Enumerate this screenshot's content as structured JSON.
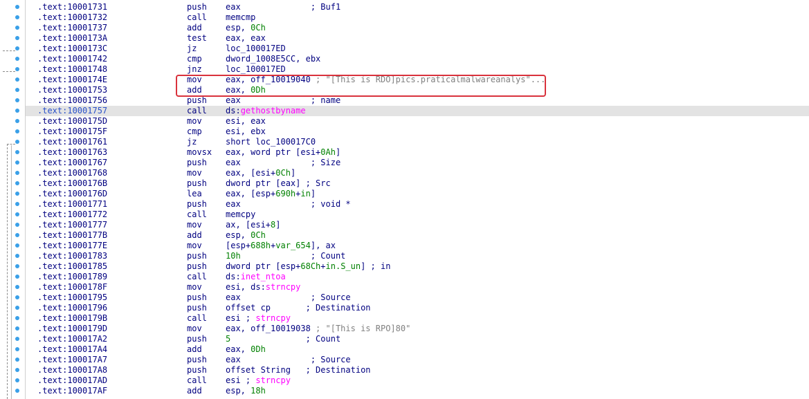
{
  "listing": {
    "rows": [
      {
        "addr": ".text:10001731",
        "mn": "push",
        "ops": [
          {
            "t": "eax",
            "c": ""
          },
          {
            "t": "              ; Buf1",
            "c": "cmt"
          }
        ]
      },
      {
        "addr": ".text:10001732",
        "mn": "call",
        "ops": [
          {
            "t": "memcmp",
            "c": ""
          }
        ]
      },
      {
        "addr": ".text:10001737",
        "mn": "add",
        "ops": [
          {
            "t": "esp, ",
            "c": ""
          },
          {
            "t": "0Ch",
            "c": "num"
          }
        ]
      },
      {
        "addr": ".text:1000173A",
        "mn": "test",
        "ops": [
          {
            "t": "eax, eax",
            "c": ""
          }
        ]
      },
      {
        "addr": ".text:1000173C",
        "mn": "jz",
        "ops": [
          {
            "t": "loc_100017ED",
            "c": ""
          }
        ]
      },
      {
        "addr": ".text:10001742",
        "mn": "cmp",
        "ops": [
          {
            "t": "dword_1008E5CC, ebx",
            "c": ""
          }
        ]
      },
      {
        "addr": ".text:10001748",
        "mn": "jnz",
        "ops": [
          {
            "t": "loc_100017ED",
            "c": ""
          }
        ]
      },
      {
        "addr": ".text:1000174E",
        "mn": "mov",
        "ops": [
          {
            "t": "eax, off_10019040 ",
            "c": ""
          },
          {
            "t": "; \"[This is RDO]pics.praticalmalwareanalys\"...",
            "c": "str"
          }
        ]
      },
      {
        "addr": ".text:10001753",
        "mn": "add",
        "ops": [
          {
            "t": "eax, ",
            "c": ""
          },
          {
            "t": "0Dh",
            "c": "num"
          }
        ]
      },
      {
        "addr": ".text:10001756",
        "mn": "push",
        "ops": [
          {
            "t": "eax",
            "c": ""
          },
          {
            "t": "              ; name",
            "c": "cmt"
          }
        ]
      },
      {
        "addr": ".text:10001757",
        "mn": "call",
        "ops": [
          {
            "t": "ds:",
            "c": ""
          },
          {
            "t": "gethostbyname",
            "c": "imp"
          }
        ],
        "hl": true
      },
      {
        "addr": ".text:1000175D",
        "mn": "mov",
        "ops": [
          {
            "t": "esi, eax",
            "c": ""
          }
        ]
      },
      {
        "addr": ".text:1000175F",
        "mn": "cmp",
        "ops": [
          {
            "t": "esi, ebx",
            "c": ""
          }
        ]
      },
      {
        "addr": ".text:10001761",
        "mn": "jz",
        "ops": [
          {
            "t": "short loc_100017C0",
            "c": ""
          }
        ]
      },
      {
        "addr": ".text:10001763",
        "mn": "movsx",
        "ops": [
          {
            "t": "eax, word ptr [esi+",
            "c": ""
          },
          {
            "t": "0Ah",
            "c": "num"
          },
          {
            "t": "]",
            "c": ""
          }
        ]
      },
      {
        "addr": ".text:10001767",
        "mn": "push",
        "ops": [
          {
            "t": "eax",
            "c": ""
          },
          {
            "t": "              ; Size",
            "c": "cmt"
          }
        ]
      },
      {
        "addr": ".text:10001768",
        "mn": "mov",
        "ops": [
          {
            "t": "eax, [esi+",
            "c": ""
          },
          {
            "t": "0Ch",
            "c": "num"
          },
          {
            "t": "]",
            "c": ""
          }
        ]
      },
      {
        "addr": ".text:1000176B",
        "mn": "push",
        "ops": [
          {
            "t": "dword ptr [eax] ; Src",
            "c": ""
          }
        ]
      },
      {
        "addr": ".text:1000176D",
        "mn": "lea",
        "ops": [
          {
            "t": "eax, [esp+",
            "c": ""
          },
          {
            "t": "690h",
            "c": "num"
          },
          {
            "t": "+",
            "c": ""
          },
          {
            "t": "in",
            "c": "num"
          },
          {
            "t": "]",
            "c": ""
          }
        ]
      },
      {
        "addr": ".text:10001771",
        "mn": "push",
        "ops": [
          {
            "t": "eax",
            "c": ""
          },
          {
            "t": "              ; void *",
            "c": "cmt"
          }
        ]
      },
      {
        "addr": ".text:10001772",
        "mn": "call",
        "ops": [
          {
            "t": "memcpy",
            "c": ""
          }
        ]
      },
      {
        "addr": ".text:10001777",
        "mn": "mov",
        "ops": [
          {
            "t": "ax, [esi+",
            "c": ""
          },
          {
            "t": "8",
            "c": "num"
          },
          {
            "t": "]",
            "c": ""
          }
        ]
      },
      {
        "addr": ".text:1000177B",
        "mn": "add",
        "ops": [
          {
            "t": "esp, ",
            "c": ""
          },
          {
            "t": "0Ch",
            "c": "num"
          }
        ]
      },
      {
        "addr": ".text:1000177E",
        "mn": "mov",
        "ops": [
          {
            "t": "[esp+",
            "c": ""
          },
          {
            "t": "688h",
            "c": "num"
          },
          {
            "t": "+",
            "c": ""
          },
          {
            "t": "var_654",
            "c": "num"
          },
          {
            "t": "], ax",
            "c": ""
          }
        ]
      },
      {
        "addr": ".text:10001783",
        "mn": "push",
        "ops": [
          {
            "t": "10h",
            "c": "num"
          },
          {
            "t": "              ; Count",
            "c": "cmt"
          }
        ]
      },
      {
        "addr": ".text:10001785",
        "mn": "push",
        "ops": [
          {
            "t": "dword ptr [esp+",
            "c": ""
          },
          {
            "t": "68Ch",
            "c": "num"
          },
          {
            "t": "+",
            "c": ""
          },
          {
            "t": "in.S_un",
            "c": "num"
          },
          {
            "t": "] ; in",
            "c": ""
          }
        ]
      },
      {
        "addr": ".text:10001789",
        "mn": "call",
        "ops": [
          {
            "t": "ds:",
            "c": ""
          },
          {
            "t": "inet_ntoa",
            "c": "imp"
          }
        ]
      },
      {
        "addr": ".text:1000178F",
        "mn": "mov",
        "ops": [
          {
            "t": "esi, ds:",
            "c": ""
          },
          {
            "t": "strncpy",
            "c": "imp"
          }
        ]
      },
      {
        "addr": ".text:10001795",
        "mn": "push",
        "ops": [
          {
            "t": "eax",
            "c": ""
          },
          {
            "t": "              ; Source",
            "c": "cmt"
          }
        ]
      },
      {
        "addr": ".text:10001796",
        "mn": "push",
        "ops": [
          {
            "t": "offset cp",
            "c": ""
          },
          {
            "t": "       ; Destination",
            "c": "cmt"
          }
        ]
      },
      {
        "addr": ".text:1000179B",
        "mn": "call",
        "ops": [
          {
            "t": "esi ; ",
            "c": ""
          },
          {
            "t": "strncpy",
            "c": "imp"
          }
        ]
      },
      {
        "addr": ".text:1000179D",
        "mn": "mov",
        "ops": [
          {
            "t": "eax, off_10019038 ",
            "c": ""
          },
          {
            "t": "; \"[This is RPO]80\"",
            "c": "str"
          }
        ]
      },
      {
        "addr": ".text:100017A2",
        "mn": "push",
        "ops": [
          {
            "t": "5",
            "c": "num"
          },
          {
            "t": "               ; Count",
            "c": "cmt"
          }
        ]
      },
      {
        "addr": ".text:100017A4",
        "mn": "add",
        "ops": [
          {
            "t": "eax, ",
            "c": ""
          },
          {
            "t": "0Dh",
            "c": "num"
          }
        ]
      },
      {
        "addr": ".text:100017A7",
        "mn": "push",
        "ops": [
          {
            "t": "eax",
            "c": ""
          },
          {
            "t": "              ; Source",
            "c": "cmt"
          }
        ]
      },
      {
        "addr": ".text:100017A8",
        "mn": "push",
        "ops": [
          {
            "t": "offset String",
            "c": ""
          },
          {
            "t": "   ; Destination",
            "c": "cmt"
          }
        ]
      },
      {
        "addr": ".text:100017AD",
        "mn": "call",
        "ops": [
          {
            "t": "esi ; ",
            "c": ""
          },
          {
            "t": "strncpy",
            "c": "imp"
          }
        ]
      },
      {
        "addr": ".text:100017AF",
        "mn": "add",
        "ops": [
          {
            "t": "esp, ",
            "c": ""
          },
          {
            "t": "18h",
            "c": "num"
          }
        ]
      }
    ]
  },
  "colors": {
    "operand": "#000080",
    "number": "#008000",
    "import": "#ff00ff",
    "string_comment": "#808080",
    "highlight_row": "#e3e3e3",
    "callout_border": "#d9323c",
    "breakpoint_dot": "#3aa0e8"
  },
  "icons": {
    "gutter_dot": "breakpoint-dot-icon"
  }
}
